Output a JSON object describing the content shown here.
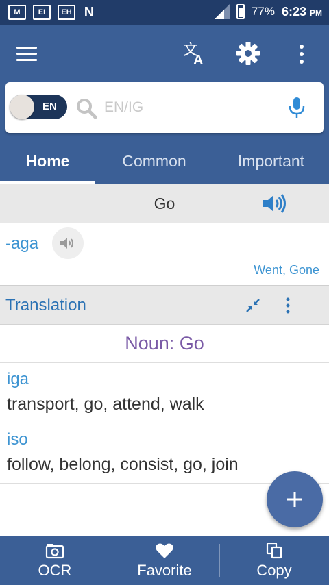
{
  "status_bar": {
    "notifications": [
      "M",
      "EI",
      "EH",
      "N"
    ],
    "battery": "77%",
    "time": "6:23",
    "ampm": "PM"
  },
  "search": {
    "toggle_label": "EN",
    "placeholder": "EN/IG",
    "value": ""
  },
  "tabs": [
    {
      "label": "Home",
      "active": true
    },
    {
      "label": "Common",
      "active": false
    },
    {
      "label": "Important",
      "active": false
    }
  ],
  "word": {
    "title": "Go",
    "definition": "-aga",
    "forms": "Went, Gone"
  },
  "translation": {
    "title": "Translation",
    "part_of_speech": "Noun: Go",
    "entries": [
      {
        "word": "iga",
        "meaning": "transport, go, attend, walk"
      },
      {
        "word": "iso",
        "meaning": "follow, belong, consist, go, join"
      }
    ]
  },
  "bottom_nav": [
    {
      "label": "OCR",
      "icon": "camera-icon"
    },
    {
      "label": "Favorite",
      "icon": "heart-icon"
    },
    {
      "label": "Copy",
      "icon": "copy-icon"
    }
  ],
  "colors": {
    "status_bar": "#213c69",
    "primary": "#3b5f96",
    "accent_blue": "#3d94d2",
    "pos_purple": "#7a5aa6",
    "fab": "#4a6ba5"
  }
}
